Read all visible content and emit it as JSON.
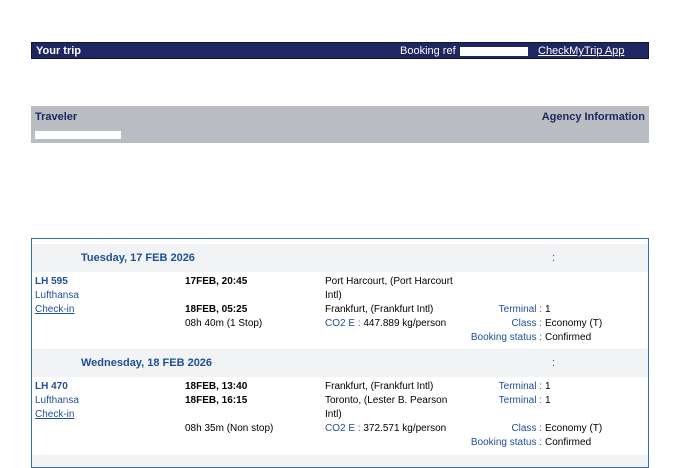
{
  "header": {
    "title": "Your trip",
    "booking_ref_label": "Booking ref",
    "app_link": "CheckMyTrip App"
  },
  "traveler_section": {
    "traveler_label": "Traveler",
    "agency_label": "Agency Information"
  },
  "days": [
    {
      "date": "Tuesday, 17 FEB 2026",
      "colon": ":",
      "flight": {
        "number": "LH 595",
        "airline": "Lufthansa",
        "checkin": "Check-in",
        "depart_time": "17FEB, 20:45",
        "arrive_time": "18FEB, 05:25",
        "duration": "08h 40m (1 Stop)",
        "from_line1": "Port Harcourt, (Port Harcourt",
        "from_line2": "Intl)",
        "to_line1": "Frankfurt, (Frankfurt Intl)",
        "co2_label": "CO2 E :",
        "co2_value": "447.889 kg/person",
        "terminal_label": "Terminal :",
        "terminal_value": "1",
        "class_label": "Class :",
        "class_value": "Economy (T)",
        "status_label": "Booking status :",
        "status_value": "Confirmed"
      }
    },
    {
      "date": "Wednesday, 18 FEB 2026",
      "colon": ":",
      "flight": {
        "number": "LH 470",
        "airline": "Lufthansa",
        "checkin": "Check-in",
        "depart_time": "18FEB, 13:40",
        "arrive_time": "18FEB, 16:15",
        "duration": "08h 35m (Non stop)",
        "from_line1": "Frankfurt, (Frankfurt Intl)",
        "to_line1": "Toronto, (Lester B. Pearson",
        "to_line2": "Intl)",
        "co2_label": "CO2 E :",
        "co2_value": "372.571 kg/person",
        "terminal1_label": "Terminal :",
        "terminal1_value": "1",
        "terminal2_label": "Terminal :",
        "terminal2_value": "1",
        "class_label": "Class :",
        "class_value": "Economy (T)",
        "status_label": "Booking status :",
        "status_value": "Confirmed"
      }
    }
  ]
}
